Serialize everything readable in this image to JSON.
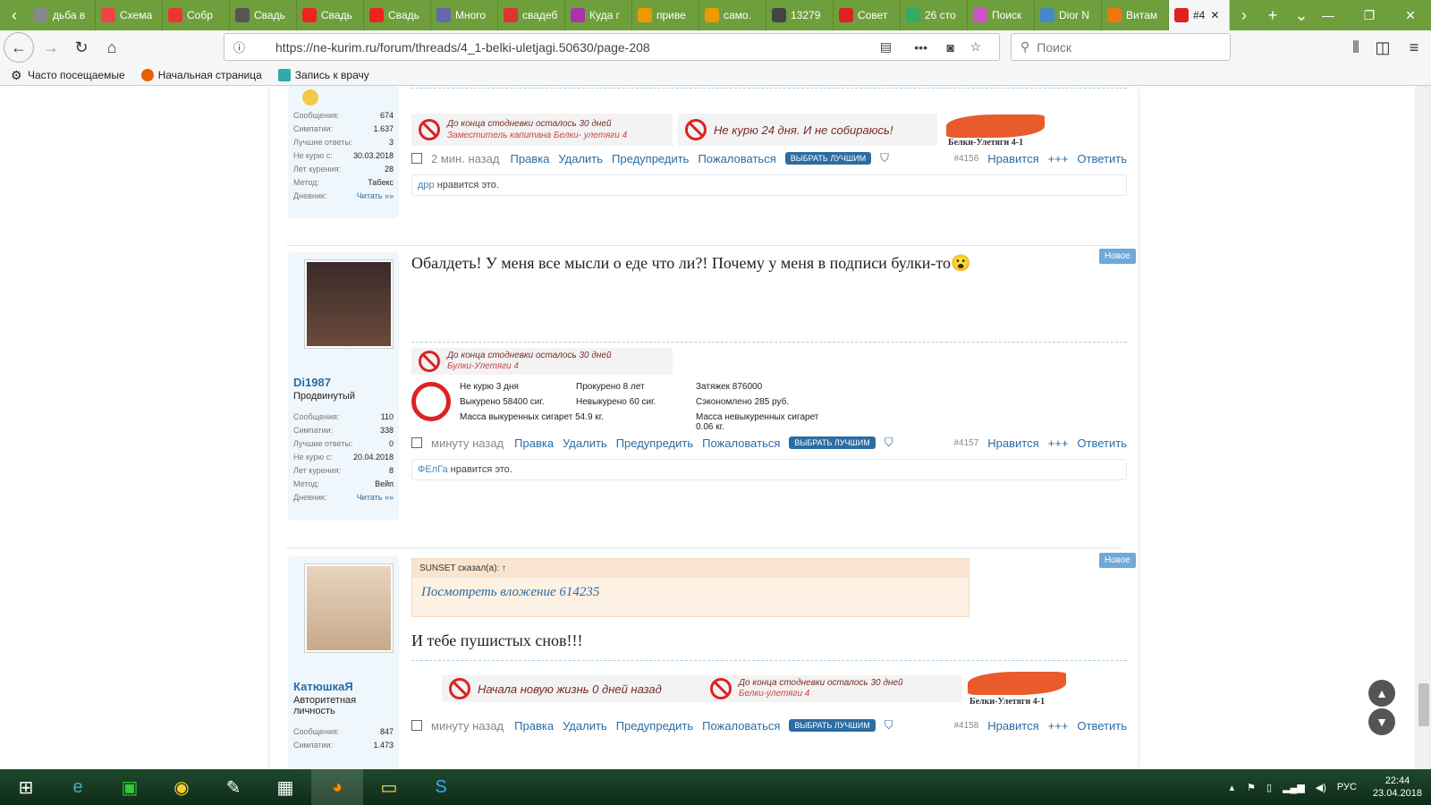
{
  "browser": {
    "tabs": [
      {
        "label": "дьба в",
        "color": "#888"
      },
      {
        "label": "Схема",
        "color": "#e44"
      },
      {
        "label": "Собр",
        "color": "#e33"
      },
      {
        "label": "Свадь",
        "color": "#555"
      },
      {
        "label": "Свадь",
        "color": "#e22"
      },
      {
        "label": "Свадь",
        "color": "#e22"
      },
      {
        "label": "Много",
        "color": "#66a"
      },
      {
        "label": "свадеб",
        "color": "#d33"
      },
      {
        "label": "Куда г",
        "color": "#a3a"
      },
      {
        "label": "приве",
        "color": "#e90"
      },
      {
        "label": "само.",
        "color": "#e90"
      },
      {
        "label": "13279",
        "color": "#444"
      },
      {
        "label": "Совет",
        "color": "#d22"
      },
      {
        "label": "26 сто",
        "color": "#3a6"
      },
      {
        "label": "Поиск",
        "color": "#c5c"
      },
      {
        "label": "Dior N",
        "color": "#48c"
      },
      {
        "label": "Витам",
        "color": "#e71"
      },
      {
        "label": "#4",
        "color": "#d22"
      }
    ],
    "url": "https://ne-kurim.ru/forum/threads/4_1-belki-uletjagi.50630/page-208",
    "search_placeholder": "Поиск",
    "bookmarks": [
      "Часто посещаемые",
      "Начальная страница",
      "Запись к врачу"
    ]
  },
  "posts": [
    {
      "stats": [
        [
          "Сообщения:",
          "674"
        ],
        [
          "Симпатии:",
          "1.637"
        ],
        [
          "Лучшие ответы:",
          "3"
        ],
        [
          "Не курю с:",
          "30.03.2018"
        ],
        [
          "Лет курения:",
          "28"
        ],
        [
          "Метод:",
          "Табекс"
        ],
        [
          "Дневник:",
          "Читать »»"
        ]
      ],
      "sig_left": "До конца стодневки осталось 30 дней",
      "sig_sub": "Заместитель капитана Белки- улетяги 4",
      "sig_right": "Не курю 24 дня. И не собираюсь!",
      "logo": "Белки-Улетяги 4-1",
      "time": "2 мин. назад",
      "num": "#4156",
      "likes_user": "дрр",
      "likes_text": " нравится это."
    },
    {
      "name": "Di1987",
      "title": "Продвинутый",
      "stats": [
        [
          "Сообщения:",
          "110"
        ],
        [
          "Симпатии:",
          "338"
        ],
        [
          "Лучшие ответы:",
          "0"
        ],
        [
          "Не курю с:",
          "20.04.2018"
        ],
        [
          "Лет курения:",
          "8"
        ],
        [
          "Метод:",
          "Вейп"
        ],
        [
          "Дневник:",
          "Читать »»"
        ]
      ],
      "text": "Обалдеть! У меня все мысли о еде что ли?! Почему у меня в подписи булки-то😮",
      "sig_left": "До конца стодневки осталось 30 дней",
      "sig_sub": "Булки-Улетяги 4",
      "counter": [
        "Не курю 3 дня",
        "Прокурено 8 лет",
        "Затяжек 876000",
        "Выкурено 58400 сиг.",
        "Невыкурено 60 сиг.",
        "Сэкономлено 285 руб.",
        "Масса выкуренных сигарет 54.9 кг.",
        "Масса невыкуренных сигарет 0.06 кг."
      ],
      "time": "минуту назад",
      "num": "#4157",
      "likes_user": "ФЕлГа",
      "likes_text": " нравится это.",
      "badge": "Новое"
    },
    {
      "name": "КатюшкаЯ",
      "title": "Авторитетная личность",
      "stats": [
        [
          "Сообщения:",
          "847"
        ],
        [
          "Симпатии:",
          "1.473"
        ]
      ],
      "quote_author": "SUNSET сказал(а): ↑",
      "quote_link": "Посмотреть вложение 614235",
      "text": "И тебе пушистых снов!!!",
      "sig_left": "Начала новую жизнь 0 дней назад",
      "sig_right": "До конца стодневки осталось 30 дней",
      "sig_sub": "Белки-улетяги 4",
      "logo": "Белки-Улетяги 4-1",
      "time": "минуту назад",
      "num": "#4158",
      "badge": "Новое"
    }
  ],
  "actions": {
    "edit": "Правка",
    "delete": "Удалить",
    "warn": "Предупредить",
    "report": "Пожаловаться",
    "best": "ВЫБРАТЬ ЛУЧШИМ",
    "like": "Нравится",
    "more": "+++",
    "reply": "Ответить"
  },
  "taskbar": {
    "lang": "РУС",
    "time": "22:44",
    "date": "23.04.2018"
  }
}
